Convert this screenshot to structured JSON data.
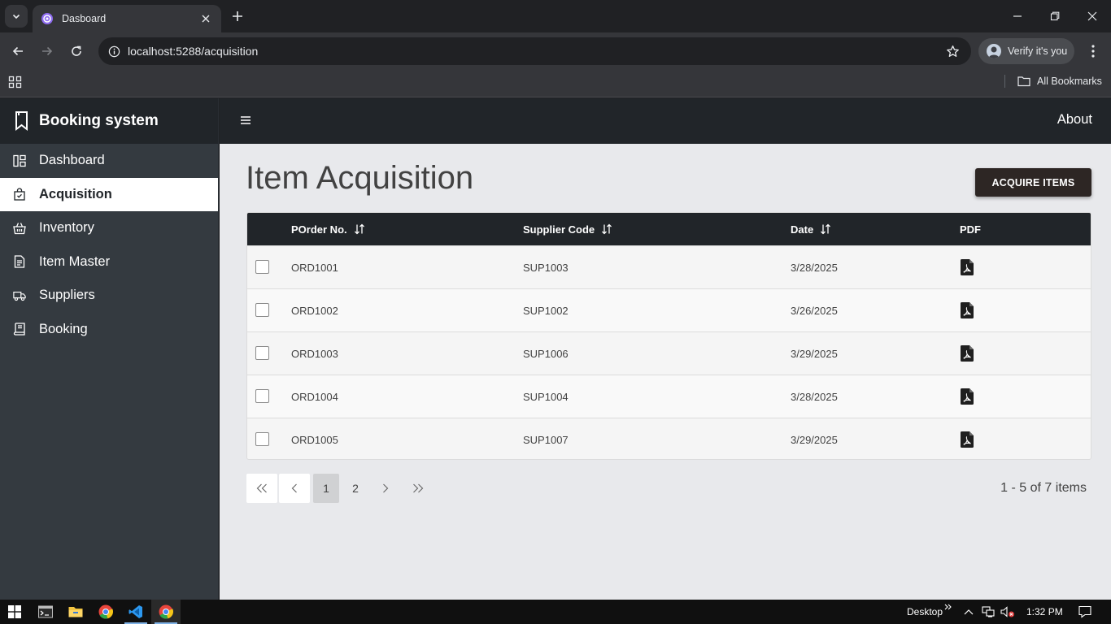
{
  "browser": {
    "tab_title": "Dasboard",
    "url": "localhost:5288/acquisition",
    "profile_label": "Verify it's you",
    "bookmarks_label": "All Bookmarks"
  },
  "app": {
    "brand": "Booking system",
    "about": "About",
    "nav": [
      {
        "label": "Dashboard",
        "icon": "dashboard-icon",
        "active": false
      },
      {
        "label": "Acquisition",
        "icon": "bag-check-icon",
        "active": true
      },
      {
        "label": "Inventory",
        "icon": "basket-icon",
        "active": false
      },
      {
        "label": "Item Master",
        "icon": "document-icon",
        "active": false
      },
      {
        "label": "Suppliers",
        "icon": "truck-icon",
        "active": false
      },
      {
        "label": "Booking",
        "icon": "book-icon",
        "active": false
      }
    ]
  },
  "page": {
    "title": "Item Acquisition",
    "acquire_button": "ACQUIRE ITEMS"
  },
  "table": {
    "columns": [
      "POrder No.",
      "Supplier Code",
      "Date",
      "PDF"
    ],
    "rows": [
      {
        "order": "ORD1001",
        "supplier": "SUP1003",
        "date": "3/28/2025"
      },
      {
        "order": "ORD1002",
        "supplier": "SUP1002",
        "date": "3/26/2025"
      },
      {
        "order": "ORD1003",
        "supplier": "SUP1006",
        "date": "3/29/2025"
      },
      {
        "order": "ORD1004",
        "supplier": "SUP1004",
        "date": "3/28/2025"
      },
      {
        "order": "ORD1005",
        "supplier": "SUP1007",
        "date": "3/29/2025"
      }
    ]
  },
  "pager": {
    "pages": [
      "1",
      "2"
    ],
    "current": "1",
    "info": "1 - 5 of 7 items"
  },
  "taskbar": {
    "desktop_label": "Desktop",
    "time": "1:32 PM"
  },
  "colors": {
    "sidebar_bg": "#343a40",
    "header_bg": "#212529",
    "content_bg": "#e8e9ec",
    "button_bg": "#2d2624",
    "pdf_icon": "#1f1f1f"
  }
}
